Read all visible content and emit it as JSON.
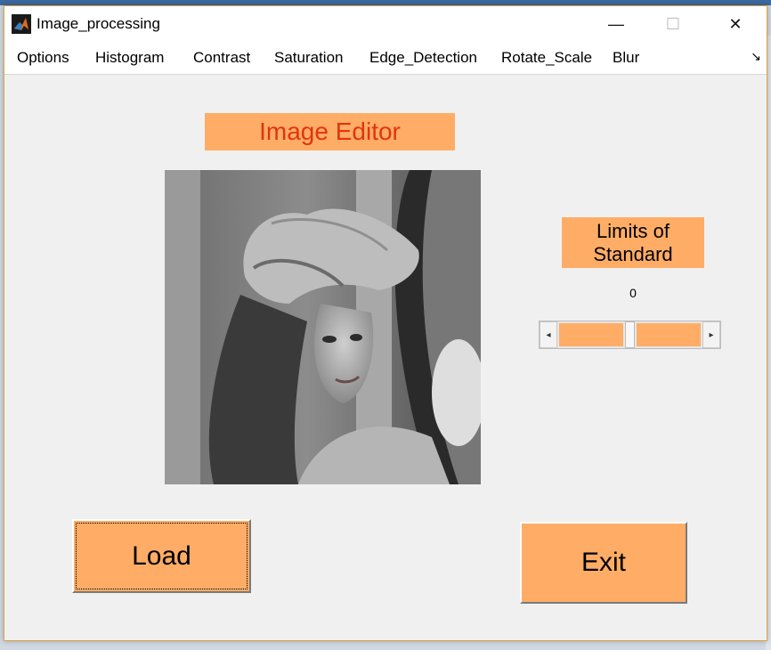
{
  "window": {
    "title": "Image_processing",
    "controls": {
      "minimize": "—",
      "maximize": "☐",
      "close": "✕"
    }
  },
  "menu": {
    "items": [
      "Options",
      "Histogram",
      "Contrast",
      "Saturation",
      "Edge_Detection",
      "Rotate_Scale",
      "Blur"
    ],
    "overflow_icon": "↘"
  },
  "editor": {
    "title": "Image Editor",
    "image_alt": "grayscale portrait of a woman wearing a wide-brimmed hat"
  },
  "limits": {
    "label_line1": "Limits of",
    "label_line2": "Standard",
    "value": "0",
    "left_arrow": "◂",
    "right_arrow": "▸"
  },
  "buttons": {
    "load": "Load",
    "exit": "Exit"
  },
  "colors": {
    "accent_orange": "#ffad66",
    "title_red": "#e2340f"
  }
}
